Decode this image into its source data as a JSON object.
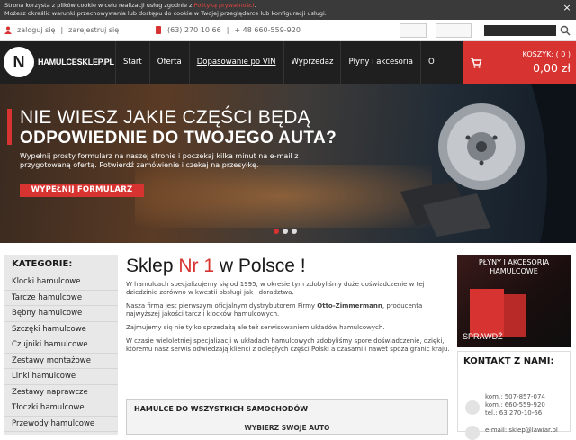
{
  "cookie_bar": {
    "line1_prefix": "Strona korzysta z plików cookie w celu realizacji usług zgodnie z ",
    "line1_link": "Polityką prywatności",
    "line1_suffix": ".",
    "line2": "Możesz określić warunki przechowywania lub dostępu do cookie w Twojej przeglądarce lub konfiguracji usługi.",
    "close": "×"
  },
  "topbar": {
    "login": "zaloguj się",
    "register": "zarejestruj się",
    "phone": "(63) 270 10 66",
    "mobile": "+ 48 660-559-920"
  },
  "nav": {
    "logo_text": "HAMULCESKLEP.PL",
    "items": [
      "Start",
      "Oferta",
      "Dopasowanie po VIN",
      "Wyprzedaż",
      "Płyny i akcesoria",
      "O"
    ],
    "cart_label": "KOSZYK: ( 0 )",
    "cart_amount": "0,00 zł"
  },
  "hero": {
    "line1": "NIE WIESZ JAKIE CZĘŚCI BĘDĄ",
    "line2": "ODPOWIEDNIE DO TWOJEGO AUTA?",
    "paragraph": "Wypełnij prosty formularz na naszej stronie i poczekaj kilka minut na e-mail z przygotowaną ofertą. Potwierdź zamówienie i czekaj na przesyłkę.",
    "button": "WYPEŁNIJ FORMULARZ"
  },
  "sidebar": {
    "heading": "KATEGORIE:",
    "items": [
      "Klocki hamulcowe",
      "Tarcze hamulcowe",
      "Bębny hamulcowe",
      "Szczęki hamulcowe",
      "Czujniki hamulcowe",
      "Zestawy montażowe",
      "Linki hamulcowe",
      "Zestawy naprawcze",
      "Tłoczki hamulcowe",
      "Przewody hamulcowe"
    ]
  },
  "main": {
    "title_a": "Sklep ",
    "title_b": "Nr 1",
    "title_c": " w Polsce !",
    "p1": "W hamulcach specjalizujemy się od 1995, w okresie tym zdobyliśmy duże doświadczenie w tej dziedzinie zarówno w kwestii obsługi jak i doradztwa.",
    "p2a": "Nasza firma jest pierwszym oficjalnym dystrybutorem Firmy ",
    "p2b": "Otto-Zimmermann",
    "p2c": ", producenta najwyższej jakości tarcz i klocków hamulcowych.",
    "p3": "Zajmujemy się nie tylko sprzedażą ale też serwisowaniem układów hamulcowych.",
    "p4": "W czasie wieloletniej specjalizacji w układach hamulcowych zdobyliśmy spore doświadczenie, dzięki, któremu nasz serwis odwiedzają klienci z odległych części Polski a czasami i nawet spoza granic kraju.",
    "cats_heading": "HAMULCE DO WSZYSTKICH SAMOCHODÓW",
    "cats_sub": "WYBIERZ SWOJE AUTO"
  },
  "promo": {
    "title": "PŁYNY I AKCESORIA HAMULCOWE",
    "cta": "SPRAWDŹ"
  },
  "contact": {
    "heading": "KONTAKT Z NAMI:",
    "kom1": "kom.: 507-857-074",
    "kom2": "kom.: 660-559-920",
    "tel": "tel.: 63 270-10-66",
    "email": "e-mail: sklep@lawiar.pl"
  }
}
